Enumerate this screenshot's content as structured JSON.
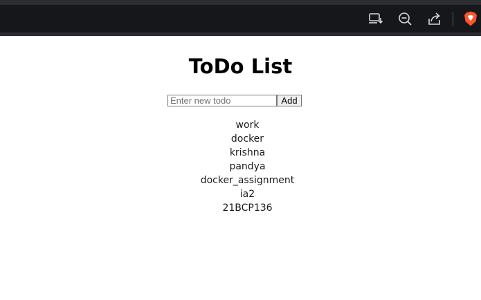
{
  "browser": {
    "icons": [
      "install-app-icon",
      "zoom-out-icon",
      "share-icon",
      "brave-shield-icon"
    ],
    "accent": "#fb542b"
  },
  "page": {
    "title": "ToDo List",
    "input_placeholder": "Enter new todo",
    "input_value": "",
    "add_label": "Add",
    "todos": [
      "work",
      "docker",
      "krishna",
      "pandya",
      "docker_assignment",
      "ia2",
      "21BCP136"
    ]
  }
}
